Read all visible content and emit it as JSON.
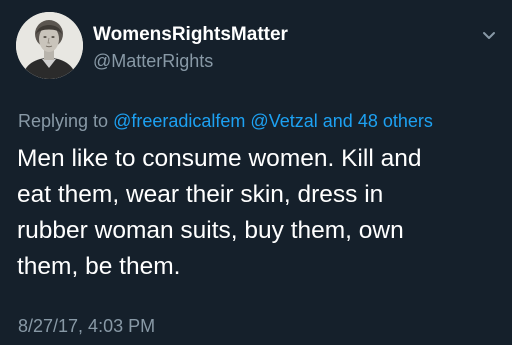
{
  "tweet": {
    "author": {
      "display_name": "WomensRightsMatter",
      "handle": "@MatterRights",
      "avatar_icon": "portrait-avatar"
    },
    "menu_icon": "chevron-down-icon",
    "reply": {
      "prefix": "Replying to",
      "mentions": [
        "@freeradicalfem",
        "@Vetzal"
      ],
      "and_word": "and",
      "others_link": "48 others"
    },
    "text_lines": [
      "Men like to consume women. Kill and",
      "eat them, wear their skin, dress in",
      "rubber woman suits, buy them, own",
      "them, be them."
    ],
    "timestamp": "8/27/17, 4:03 PM"
  },
  "colors": {
    "background": "#15202b",
    "text_primary": "#ffffff",
    "text_secondary": "#8899a6",
    "link": "#1da1f2"
  }
}
